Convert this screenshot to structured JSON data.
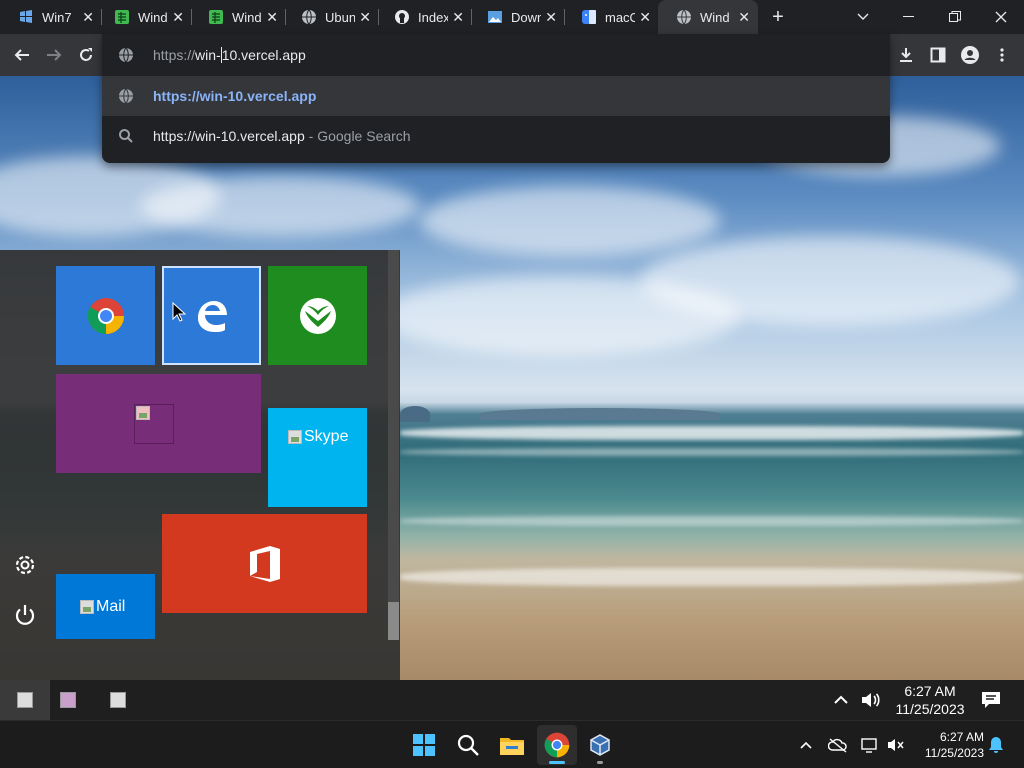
{
  "browser": {
    "tabs": [
      {
        "title": "Win7",
        "icon": "win7-icon",
        "color": "#6aa7e8"
      },
      {
        "title": "Windo",
        "icon": "spreadsheet-icon",
        "color": "#3fb950"
      },
      {
        "title": "Windo",
        "icon": "spreadsheet-icon",
        "color": "#3fb950"
      },
      {
        "title": "Ubun",
        "icon": "globe-icon",
        "color": "#bdc1c6"
      },
      {
        "title": "Index",
        "icon": "github-icon",
        "color": "#e8eaed"
      },
      {
        "title": "Down",
        "icon": "image-icon",
        "color": "#5aa0e0"
      },
      {
        "title": "macO",
        "icon": "finder-icon",
        "color": "#3b82f6"
      },
      {
        "title": "Windo",
        "icon": "globe-icon",
        "color": "#bdc1c6"
      }
    ],
    "omnibox": {
      "input_prefix": "https://",
      "input_before_caret": "win-",
      "input_after_caret": "10.vercel.app",
      "suggestion_url": "https://win-10.vercel.app",
      "search_query": "https://win-10.vercel.app",
      "search_suffix": " - Google Search"
    }
  },
  "start_menu": {
    "tiles": [
      {
        "name": "Chrome",
        "color": "#2d79d8"
      },
      {
        "name": "Edge",
        "color": "#2d79d8"
      },
      {
        "name": "Xbox",
        "color": "#1e8c1e"
      },
      {
        "name": "",
        "color": "#772d78"
      },
      {
        "name": "Skype",
        "label": "Skype",
        "color": "#00b4f0"
      },
      {
        "name": "Office",
        "color": "#d3391f"
      },
      {
        "name": "Mail",
        "label": "Mail",
        "color": "#0078d7"
      }
    ]
  },
  "web_taskbar": {
    "time": "6:27 AM",
    "date": "11/25/2023"
  },
  "host_taskbar": {
    "time": "6:27 AM",
    "date": "11/25/2023",
    "accent": "#4cc2ff"
  }
}
